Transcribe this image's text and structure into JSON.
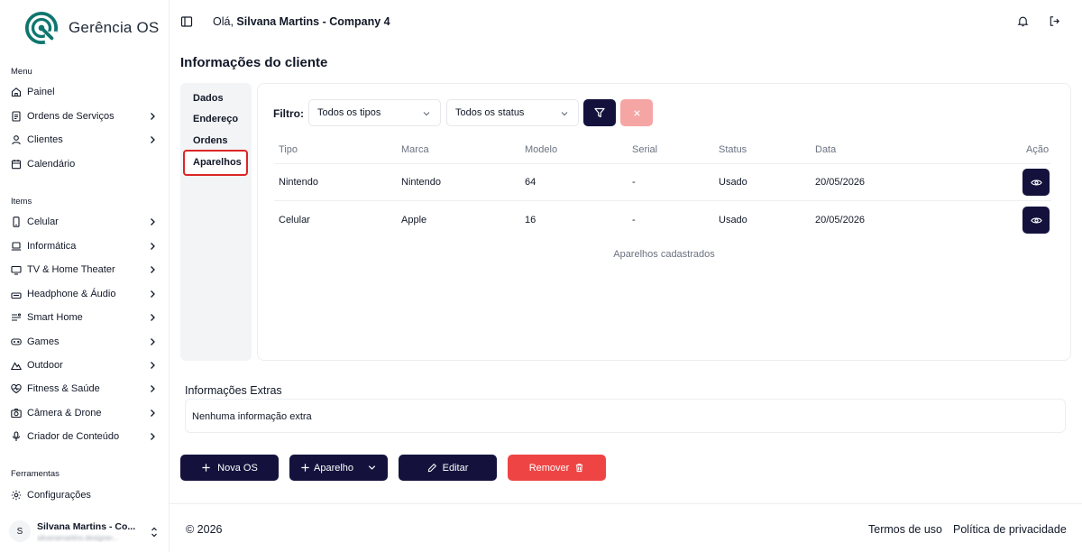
{
  "brand": {
    "name": "Gerência OS",
    "accent": "#14123d",
    "logo_color": "#0f766e"
  },
  "header": {
    "greeting_prefix": "Olá, ",
    "greeting_name": "Silvana Martins - Company 4"
  },
  "sidebar": {
    "sections": [
      {
        "label": "Menu"
      },
      {
        "label": "Items"
      },
      {
        "label": "Ferramentas"
      }
    ],
    "menu": [
      {
        "label": "Painel",
        "icon": "home-icon"
      },
      {
        "label": "Ordens de Serviços",
        "icon": "document-icon"
      },
      {
        "label": "Clientes",
        "icon": "user-icon"
      },
      {
        "label": "Calendário",
        "icon": "calendar-icon"
      }
    ],
    "items": [
      {
        "label": "Celular",
        "icon": "smartphone-icon"
      },
      {
        "label": "Informática",
        "icon": "laptop-icon"
      },
      {
        "label": "TV & Home Theater",
        "icon": "tv-icon"
      },
      {
        "label": "Headphone & Áudio",
        "icon": "headphones-icon"
      },
      {
        "label": "Smart Home",
        "icon": "smart-home-icon"
      },
      {
        "label": "Games",
        "icon": "gamepad-icon"
      },
      {
        "label": "Outdoor",
        "icon": "mountain-icon"
      },
      {
        "label": "Fitness & Saúde",
        "icon": "heart-pulse-icon"
      },
      {
        "label": "Câmera & Drone",
        "icon": "camera-icon"
      },
      {
        "label": "Criador de Conteúdo",
        "icon": "microphone-icon"
      }
    ],
    "tools": [
      {
        "label": "Configurações",
        "icon": "gear-icon"
      }
    ],
    "user": {
      "initial": "S",
      "name": "Silvana Martins - Co...",
      "email": "silvanamartins.designer..."
    }
  },
  "page": {
    "title": "Informações do cliente"
  },
  "tabs": [
    {
      "label": "Dados"
    },
    {
      "label": "Endereço"
    },
    {
      "label": "Ordens"
    },
    {
      "label": "Aparelhos",
      "active": true
    }
  ],
  "filter": {
    "label": "Filtro:",
    "type_select": "Todos os tipos",
    "status_select": "Todos os status"
  },
  "table": {
    "headers": [
      "Tipo",
      "Marca",
      "Modelo",
      "Serial",
      "Status",
      "Data",
      "Ação"
    ],
    "rows": [
      {
        "tipo": "Nintendo",
        "marca": "Nintendo",
        "modelo": "64",
        "serial": "-",
        "status": "Usado",
        "data": "20/05/2026"
      },
      {
        "tipo": "Celular",
        "marca": "Apple",
        "modelo": "16",
        "serial": "-",
        "status": "Usado",
        "data": "20/05/2026"
      }
    ],
    "caption": "Aparelhos cadastrados"
  },
  "extras": {
    "title": "Informações Extras",
    "text": "Nenhuma informação extra"
  },
  "actions": {
    "new_os": "Nova OS",
    "device": "Aparelho",
    "edit": "Editar",
    "remove": "Remover"
  },
  "footer": {
    "copyright": "© 2026",
    "terms": "Termos de uso",
    "privacy": "Política de privacidade"
  }
}
